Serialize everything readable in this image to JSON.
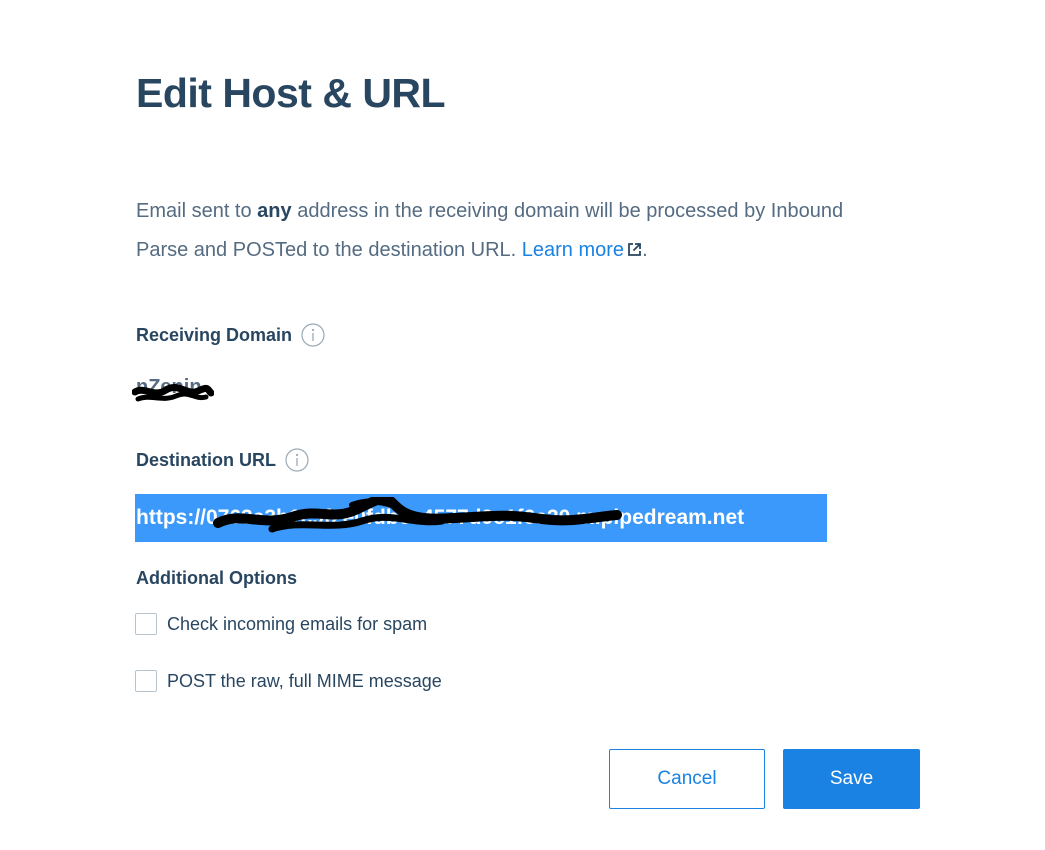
{
  "dialog": {
    "title": "Edit Host & URL",
    "description": {
      "part1": "Email sent to ",
      "bold": "any",
      "part2": " address in the receiving domain will be processed by Inbound Parse and POSTed to the destination URL. ",
      "link": "Learn more",
      "end": "."
    },
    "receiving_domain": {
      "label": "Receiving Domain",
      "value": "nZenin"
    },
    "destination_url": {
      "label": "Destination URL",
      "value": "https://0763a3b1c9f2e0fdb6c4577d9e1f6a20.m.pipedream.net"
    },
    "additional_options": {
      "label": "Additional Options",
      "options": [
        {
          "label": "Check incoming emails for spam",
          "checked": false
        },
        {
          "label": "POST the raw, full MIME message",
          "checked": false
        }
      ]
    },
    "buttons": {
      "cancel": "Cancel",
      "save": "Save"
    }
  },
  "colors": {
    "title": "#294661",
    "body_text": "#546b81",
    "link": "#1a82e2",
    "primary": "#1a82e2",
    "selection": "#3b99fc"
  },
  "icons": {
    "info": "info-circle-icon",
    "external_link": "external-link-icon"
  }
}
